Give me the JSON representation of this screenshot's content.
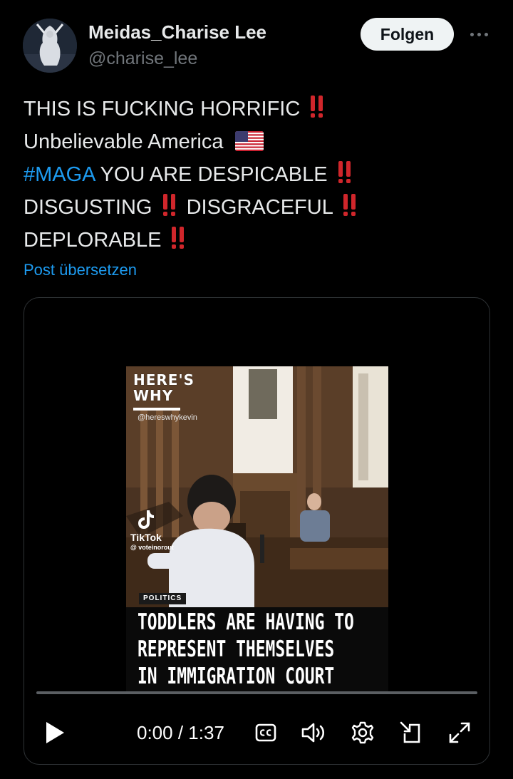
{
  "author": {
    "display_name": "Meidas_Charise Lee",
    "handle": "@charise_lee",
    "avatar_icon": "avatar-photo"
  },
  "actions": {
    "follow_label": "Folgen",
    "more_icon": "more-horizontal-icon"
  },
  "tweet": {
    "line1_text": "THIS IS FUCKING HORRIFIC",
    "line2_text": "Unbelievable America",
    "line3_hashtag": "#MAGA",
    "line3_text": " YOU ARE DESPICABLE",
    "line4_part1": "DISGUSTING",
    "line4_part2": " DISGRACEFUL",
    "line5_text": "DEPLORABLE",
    "emoji_bang": "double-exclamation-icon",
    "emoji_flag": "us-flag-icon",
    "translate_label": "Post übersetzen"
  },
  "video": {
    "overlay_brand_line1": "HERE'S",
    "overlay_brand_line2": "WHY",
    "overlay_handle": "@hereswhykevin",
    "tiktok_label": "TikTok",
    "tiktok_user": "@ voteinorout",
    "category": "POLITICS",
    "headline": [
      "TODDLERS ARE HAVING TO",
      "REPRESENT THEMSELVES",
      "IN IMMIGRATION COURT"
    ],
    "time_current": "0:00",
    "time_total": "1:37",
    "progress_fraction": 0.0
  },
  "colors": {
    "background": "#000000",
    "text": "#e7e9ea",
    "secondary": "#71767b",
    "accent": "#1d9bf0",
    "emoji_red": "#d0262b"
  }
}
